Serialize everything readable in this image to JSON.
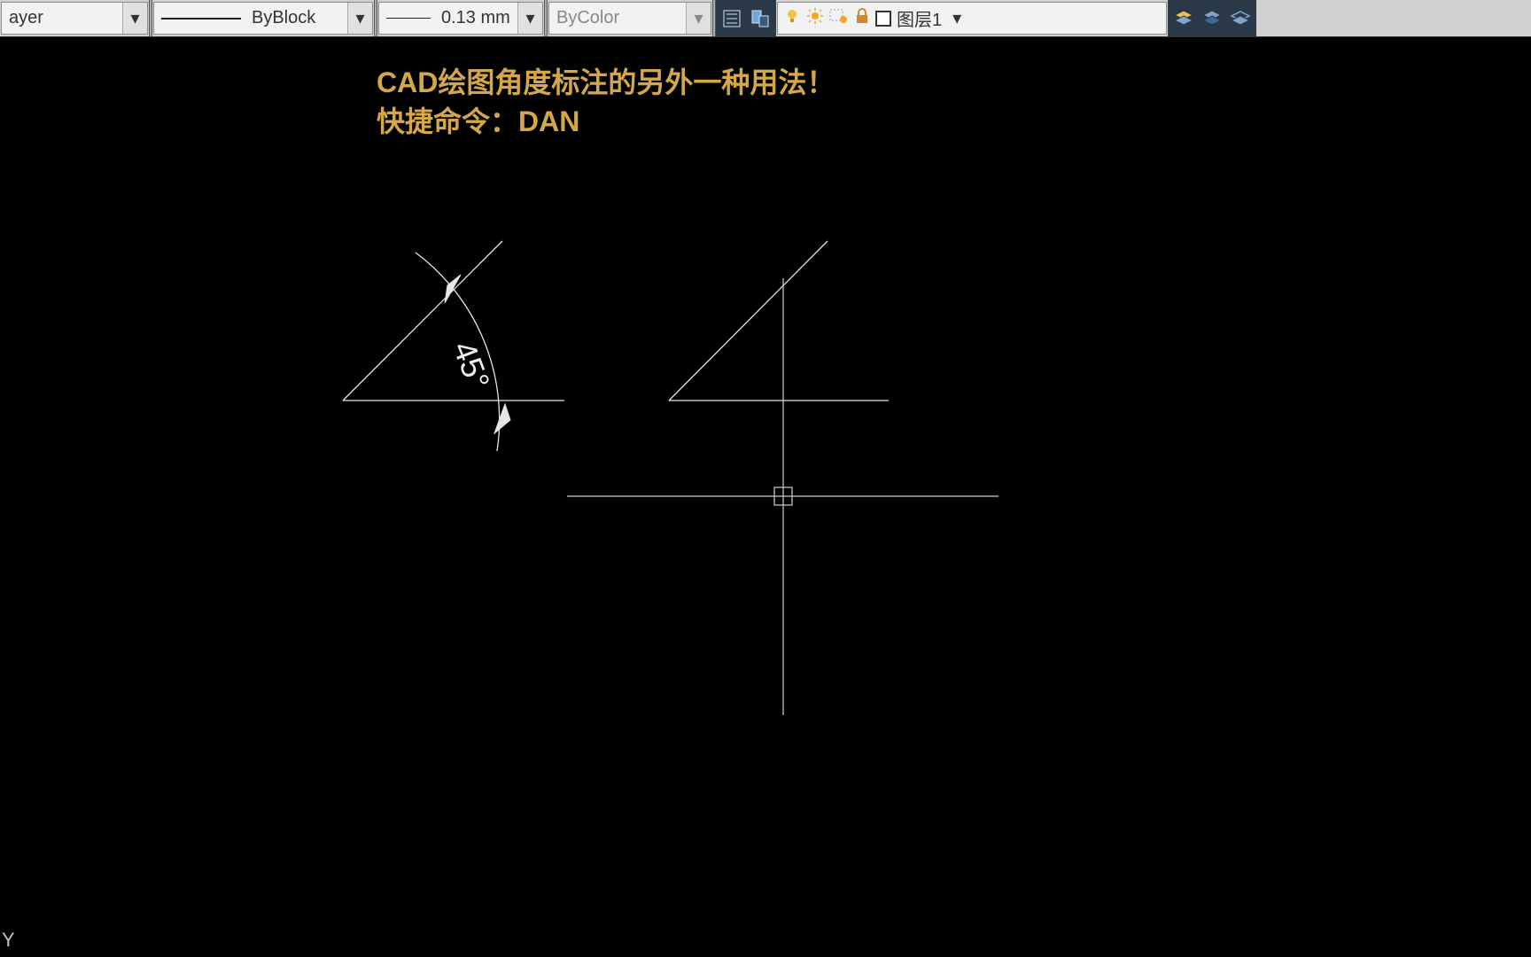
{
  "toolbar": {
    "layer_dd_label": "ayer",
    "linetype_dd_label": "ByBlock",
    "lineweight_dd_label": "0.13 mm",
    "color_dd_label": "ByColor",
    "current_layer": "图层1"
  },
  "canvas": {
    "title_line1": "CAD绘图角度标注的另外一种用法！",
    "title_line2": "快捷命令：DAN",
    "angle_dim_value": "45°",
    "axis_y_label": "Y"
  },
  "icons": {
    "chevron_down": "▾",
    "panel1_a": "list-icon",
    "panel1_b": "properties-icon",
    "bulb_on": "bulb-icon",
    "sun": "sun-icon",
    "viewport": "viewport-icon",
    "lock": "lock-icon",
    "stack1": "layers-icon",
    "stack2": "layerstate-icon",
    "stack3": "layeriso-icon"
  }
}
